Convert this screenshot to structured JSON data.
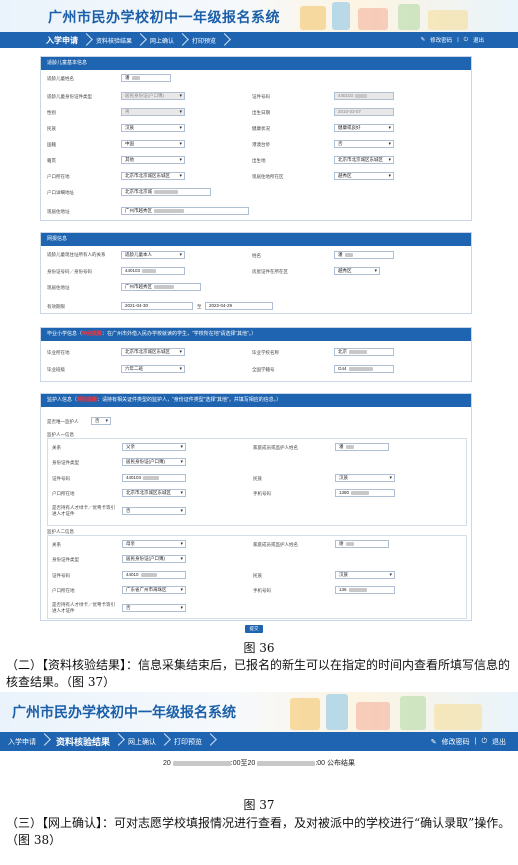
{
  "system_title": "广州市民办学校初中一年级报名系统",
  "nav": {
    "items": [
      "入学申请",
      "资料核验结果",
      "网上确认",
      "打印预览"
    ],
    "change_password": "修改密码",
    "logout": "退出"
  },
  "child_info": {
    "header": "适龄儿童基本信息",
    "name_label": "适龄儿童姓名",
    "name_value": "潘",
    "id_type_label": "适龄儿童身份证件类型",
    "id_type_value": "居民身份证(户口簿)",
    "id_no_label": "证件号码",
    "id_no_value": "440103",
    "gender_label": "性别",
    "gender_value": "男",
    "birth_label": "出生日期",
    "birth_value": "2010-03-07",
    "ethnicity_label": "民族",
    "ethnicity_value": "汉族",
    "health_label": "健康状况",
    "health_value": "健康或良好",
    "nationality_label": "国籍",
    "nationality_value": "中国",
    "hkmt_label": "港澳台侨",
    "hkmt_value": "否",
    "native_label": "籍贯",
    "native_value": "其他",
    "birthplace_label": "出生地",
    "birthplace_value": "北京市北京城区东城区",
    "hukou_label": "户口所在地",
    "hukou_value": "北京市北京城区东城区",
    "hukou_district_label": "现居住地所在区",
    "hukou_district_value": "越秀区",
    "hukou_addr_label": "户口详细地址",
    "hukou_addr_value": "北京市北京城",
    "address_label": "现居住地址",
    "address_value": "广州市越秀区"
  },
  "applicant": {
    "header": "网报信息",
    "relation_label": "适龄儿童现住址所有人的关系",
    "relation_value": "适龄儿童本人",
    "owner_name_label": "姓名",
    "owner_name_value": "潘",
    "owner_id_label": "身份证号码／身份号码",
    "owner_id_value": "440103",
    "district_label": "房屋证件在所在区",
    "district_value": "越秀区",
    "addr_label": "现居住地址",
    "addr_value": "广州市越秀区",
    "valid_label": "有效期限",
    "valid_from": "2021-04-30",
    "valid_to_sep": "至",
    "valid_to": "2022-04-29"
  },
  "school": {
    "header_prefix": "毕业小学信息（",
    "header_red": "特别提醒",
    "header_suffix": "：在广州市外借入民办学校就读的学生，“学校所在地”请选择“其他”。）",
    "grad_place_label": "毕业所在地",
    "grad_place_value": "北京市北京城区东城区",
    "grad_school_label": "毕业学校名称",
    "grad_school_value": "北京",
    "grad_class_label": "毕业班级",
    "grad_class_value": "六年二班",
    "student_no_label": "全国学籍号",
    "student_no_value": "G44"
  },
  "guardians": {
    "header_prefix": "监护人信息（",
    "header_red": "特别提醒",
    "header_suffix": "：请持有相关证件类型的监护人，“身份证件类型”选择“其他”，并填写相应的信息。）",
    "single_label": "是否唯一监护人",
    "single_value": "否",
    "g1": {
      "title": "监护人一信息",
      "rel_label": "关系",
      "rel_value": "父亲",
      "name_label": "家庭成员或监护人姓名",
      "name_value": "潘",
      "idtype_label": "身份证件类型",
      "idtype_value": "居民身份证(户口簿)",
      "idno_label": "证件号码",
      "idno_value": "440103",
      "eth_label": "民族",
      "eth_value": "汉族",
      "hukou_label": "户口所在地",
      "hukou_value": "北京市北京城区东城区",
      "phone_label": "手机号码",
      "phone_value": "1380",
      "permit_label": "是否持有人才绿卡／优粤卡等引进人才证件",
      "permit_value": "否"
    },
    "g2": {
      "title": "监护人二信息",
      "rel_label": "关系",
      "rel_value": "母亲",
      "name_label": "家庭成员或监护人姓名",
      "name_value": "谢",
      "idtype_label": "身份证件类型",
      "idtype_value": "居民身份证(户口簿)",
      "idno_label": "证件号码",
      "idno_value": "44010",
      "eth_label": "民族",
      "eth_value": "汉族",
      "hukou_label": "户口所在地",
      "hukou_value": "广东省广州市海珠区",
      "phone_label": "手机号码",
      "phone_value": "136",
      "permit_label": "是否持有人才绿卡／优粤卡等引进人才证件",
      "permit_value": "否"
    }
  },
  "submit_label": "提交",
  "fig36": "图 36",
  "para2": "（二）【资料核验结果】：信息采集结束后，已报名的新生可以在指定的时间内查看所填写信息的核查结果。（图 37）",
  "result": {
    "prefix": "20",
    "middle": ":00至20",
    "suffix": ":00 公布结果"
  },
  "fig37": "图 37",
  "para3": "（三）【网上确认】：可对志愿学校填报情况进行查看，及对被派中的学校进行“确认录取”操作。（图 38）"
}
